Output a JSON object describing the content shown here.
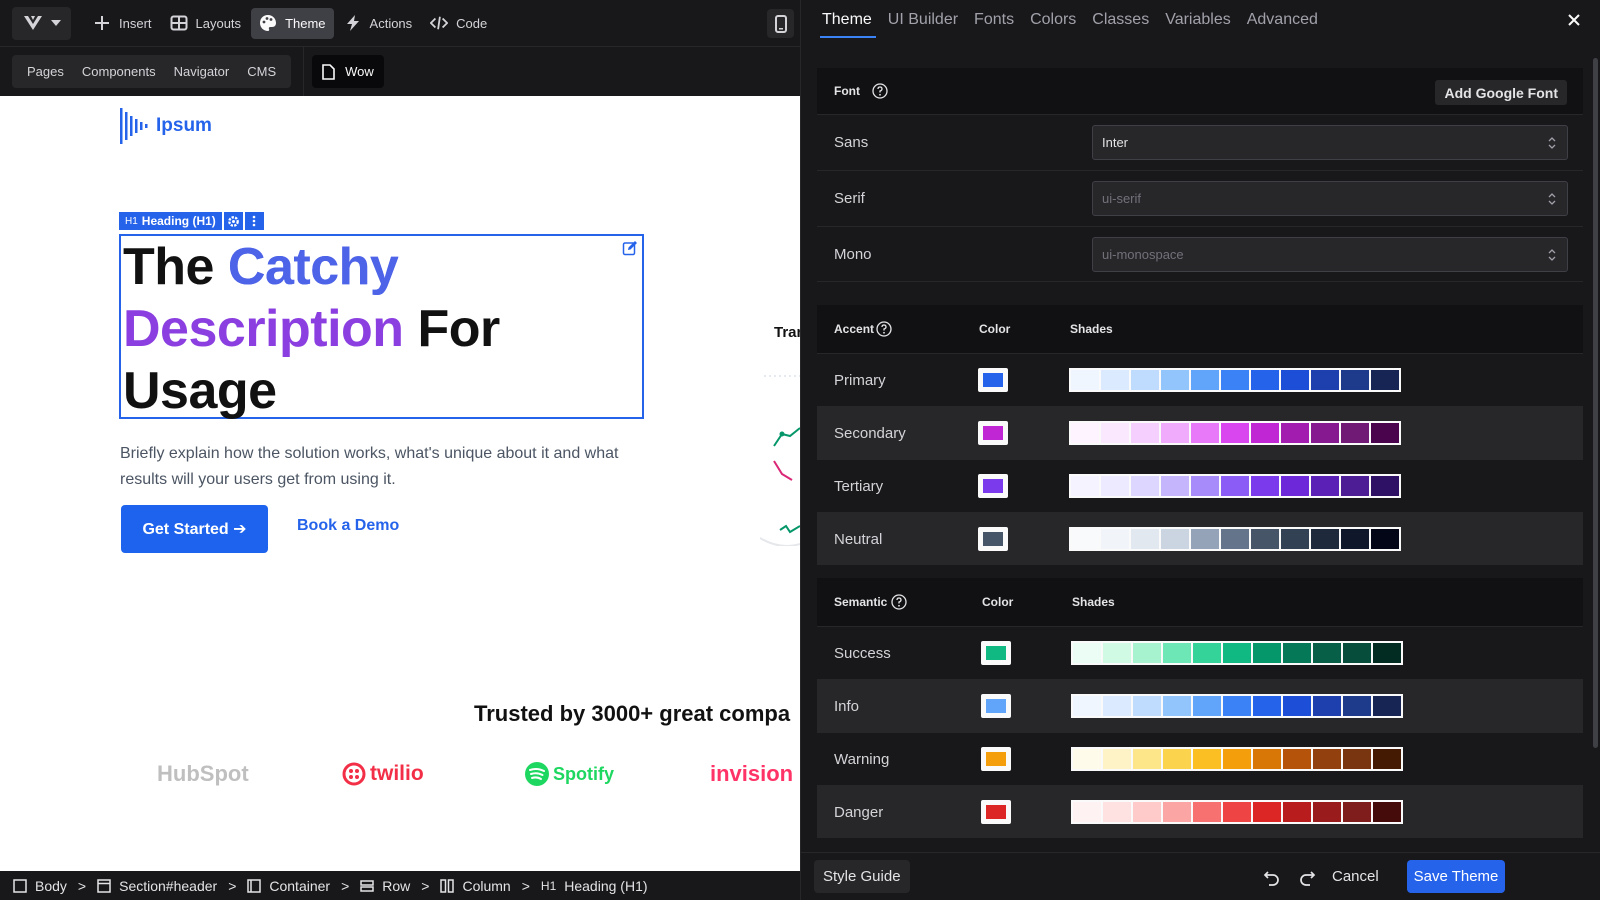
{
  "toolbar": {
    "items": [
      {
        "label": "Insert",
        "icon": "plus-icon"
      },
      {
        "label": "Layouts",
        "icon": "layouts-icon"
      },
      {
        "label": "Theme",
        "icon": "palette-icon",
        "active": true
      },
      {
        "label": "Actions",
        "icon": "bolt-icon"
      },
      {
        "label": "Code",
        "icon": "code-icon"
      }
    ]
  },
  "subbar": {
    "tabs": [
      "Pages",
      "Components",
      "Navigator",
      "CMS"
    ],
    "page": "Wow"
  },
  "canvas": {
    "brand": "Ipsum",
    "h1_tag": "Heading (H1)",
    "h1_tag_prefix": "H1",
    "heading": {
      "w1": "The",
      "w2": "Catchy",
      "w3": "Description",
      "w4": "For",
      "w5": "Usage"
    },
    "description": "Briefly explain how the solution works, what's unique about it and what results will your users get from using it.",
    "primary_button": "Get Started ➔",
    "secondary_link": "Book a Demo",
    "side_card_title": "Tran",
    "trusted": "Trusted by 3000+ great compa",
    "logos": [
      "HubSpot",
      "twilio",
      "Spotify",
      "invision"
    ]
  },
  "breadcrumb": {
    "items": [
      "Body",
      "Section#header",
      "Container",
      "Row",
      "Column",
      "Heading (H1)"
    ],
    "last_prefix": "H1"
  },
  "panel": {
    "tabs": [
      "Theme",
      "UI Builder",
      "Fonts",
      "Colors",
      "Classes",
      "Variables",
      "Advanced"
    ],
    "active_tab": "Theme",
    "font": {
      "title": "Font",
      "add_button": "Add Google Font",
      "rows": [
        {
          "label": "Sans",
          "value": "Inter"
        },
        {
          "label": "Serif",
          "value": "ui-serif"
        },
        {
          "label": "Mono",
          "value": "ui-monospace"
        }
      ]
    },
    "accent": {
      "title": "Accent",
      "col_color": "Color",
      "col_shades": "Shades",
      "rows": [
        {
          "label": "Primary",
          "color": "#2563eb",
          "shades": [
            "#eff6ff",
            "#dbeafe",
            "#bfdbfe",
            "#93c5fd",
            "#60a5fa",
            "#3b82f6",
            "#2563eb",
            "#1d4ed8",
            "#1e40af",
            "#1e3a8a",
            "#172554"
          ]
        },
        {
          "label": "Secondary",
          "color": "#c026d3",
          "shades": [
            "#fdf4ff",
            "#fae8ff",
            "#f5d0fe",
            "#f0abfc",
            "#e879f9",
            "#d946ef",
            "#c026d3",
            "#a21caf",
            "#86198f",
            "#701a75",
            "#4a044e"
          ]
        },
        {
          "label": "Tertiary",
          "color": "#7c3aed",
          "shades": [
            "#f5f3ff",
            "#ede9fe",
            "#ddd6fe",
            "#c4b5fd",
            "#a78bfa",
            "#8b5cf6",
            "#7c3aed",
            "#6d28d9",
            "#5b21b6",
            "#4c1d95",
            "#2e1065"
          ]
        },
        {
          "label": "Neutral",
          "color": "#475569",
          "shades": [
            "#f8fafc",
            "#f1f5f9",
            "#e2e8f0",
            "#cbd5e1",
            "#94a3b8",
            "#64748b",
            "#475569",
            "#334155",
            "#1e293b",
            "#0f172a",
            "#020617"
          ]
        }
      ]
    },
    "semantic": {
      "title": "Semantic",
      "col_color": "Color",
      "col_shades": "Shades",
      "rows": [
        {
          "label": "Success",
          "color": "#10b981",
          "shades": [
            "#ecfdf5",
            "#d1fae5",
            "#a7f3d0",
            "#6ee7b7",
            "#34d399",
            "#10b981",
            "#059669",
            "#047857",
            "#065f46",
            "#064e3b",
            "#022c22"
          ]
        },
        {
          "label": "Info",
          "color": "#60a5fa",
          "shades": [
            "#eff6ff",
            "#dbeafe",
            "#bfdbfe",
            "#93c5fd",
            "#60a5fa",
            "#3b82f6",
            "#2563eb",
            "#1d4ed8",
            "#1e40af",
            "#1e3a8a",
            "#172554"
          ]
        },
        {
          "label": "Warning",
          "color": "#f59e0b",
          "shades": [
            "#fffbeb",
            "#fef3c7",
            "#fde68a",
            "#fcd34d",
            "#fbbf24",
            "#f59e0b",
            "#d97706",
            "#b45309",
            "#92400e",
            "#78350f",
            "#451a03"
          ]
        },
        {
          "label": "Danger",
          "color": "#dc2626",
          "shades": [
            "#fef2f2",
            "#fee2e2",
            "#fecaca",
            "#fca5a5",
            "#f87171",
            "#ef4444",
            "#dc2626",
            "#b91c1c",
            "#991b1b",
            "#7f1d1d",
            "#450a0a"
          ]
        }
      ]
    },
    "footer": {
      "style_guide": "Style Guide",
      "cancel": "Cancel",
      "save": "Save Theme"
    }
  }
}
